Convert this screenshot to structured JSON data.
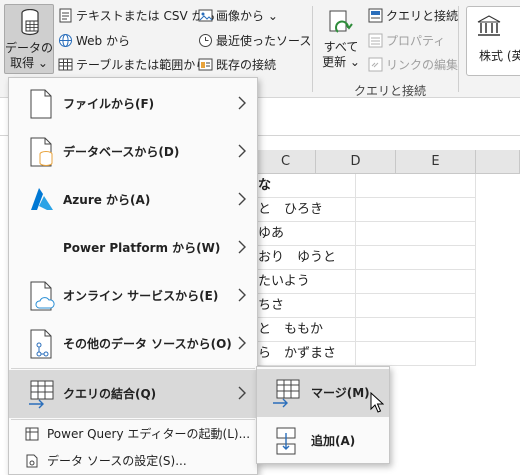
{
  "ribbon": {
    "get_data": {
      "label_line1": "データの",
      "label_line2": "取得 ⌄"
    },
    "text_csv": "テキストまたは CSV から",
    "web": "Web から",
    "table_range": "テーブルまたは範囲から",
    "image": "画像から ⌄",
    "recent_sources": "最近使ったソース",
    "existing_connections": "既存の接続",
    "refresh_all": {
      "line1": "すべて",
      "line2": "更新 ⌄"
    },
    "queries_connections": "クエリと接続",
    "properties": "プロパティ",
    "edit_links": "リンクの編集",
    "group_label": "クエリと接続",
    "stock": "株式 (英"
  },
  "grid": {
    "columns": [
      "C",
      "D",
      "E"
    ],
    "cells": [
      "な",
      "と　ひろき",
      "ゆあ",
      "おり　ゆうと",
      "たいよう",
      "ちさ",
      "と　ももか",
      "ら　かずまさ"
    ]
  },
  "menu": {
    "items": [
      {
        "label": "ファイルから(F)",
        "icon": "file-icon"
      },
      {
        "label": "データベースから(D)",
        "icon": "database-icon"
      },
      {
        "label": "Azure から(A)",
        "icon": "azure-icon"
      },
      {
        "label": "Power Platform から(W)",
        "icon": "none"
      },
      {
        "label": "オンライン サービスから(E)",
        "icon": "cloud-icon"
      },
      {
        "label": "その他のデータ ソースから(O)",
        "icon": "other-sources-icon"
      },
      {
        "label": "クエリの結合(Q)",
        "icon": "combine-icon"
      }
    ],
    "power_query": "Power Query エディターの起動(L)...",
    "data_source_settings": "データ ソースの設定(S)..."
  },
  "submenu": {
    "merge": "マージ(M)",
    "append": "追加(A)"
  },
  "colors": {
    "azure_blue": "#0078d4",
    "green_refresh": "#2e8b3a",
    "db_orange": "#e8a33c",
    "menu_highlight": "#d9d9d9"
  }
}
